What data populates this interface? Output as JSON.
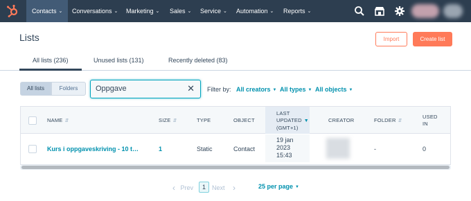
{
  "nav": {
    "items": [
      {
        "label": "Contacts"
      },
      {
        "label": "Conversations"
      },
      {
        "label": "Marketing"
      },
      {
        "label": "Sales"
      },
      {
        "label": "Service"
      },
      {
        "label": "Automation"
      },
      {
        "label": "Reports"
      }
    ],
    "icons": [
      "hubspot-logo-icon",
      "search-icon",
      "marketplace-icon",
      "gear-icon"
    ],
    "colors": {
      "bar": "#2d3e50",
      "active": "#425b76",
      "accent": "#ff7a59"
    }
  },
  "header": {
    "title": "Lists",
    "import_label": "Import",
    "create_label": "Create list"
  },
  "tabs": [
    {
      "label": "All lists (236)",
      "active": true
    },
    {
      "label": "Unused lists (131)",
      "active": false
    },
    {
      "label": "Recently deleted (83)",
      "active": false
    }
  ],
  "filters": {
    "view_all": "All lists",
    "view_folders": "Folders",
    "search_value": "Oppgave",
    "filter_by_label": "Filter by:",
    "creators": "All creators",
    "types": "All types",
    "objects": "All objects"
  },
  "table": {
    "columns": {
      "name": "NAME",
      "size": "SIZE",
      "type": "TYPE",
      "object": "OBJECT",
      "last_updated_1": "LAST",
      "last_updated_2": "UPDATED",
      "last_updated_3": "(GMT+1)",
      "creator": "CREATOR",
      "folder": "FOLDER",
      "used_in_1": "USED",
      "used_in_2": "IN"
    },
    "rows": [
      {
        "name": "Kurs i oppgaveskriving - 10 t…",
        "size": "1",
        "type": "Static",
        "object": "Contact",
        "updated_date": "19 jan",
        "updated_year": "2023",
        "updated_time": "15:43",
        "folder": "-",
        "used_in": "0"
      }
    ]
  },
  "pagination": {
    "prev": "Prev",
    "current": "1",
    "next": "Next",
    "per_page": "25 per page"
  }
}
